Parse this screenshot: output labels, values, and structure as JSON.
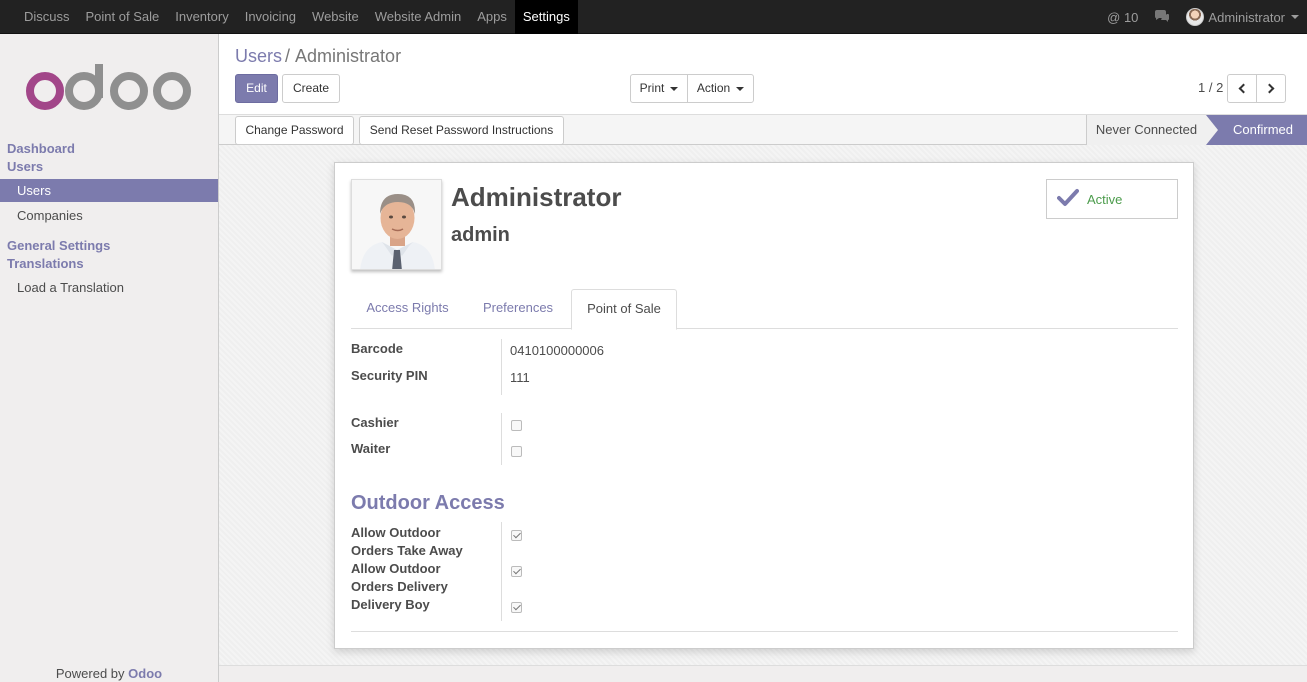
{
  "topbar": {
    "menu": [
      "Discuss",
      "Point of Sale",
      "Inventory",
      "Invoicing",
      "Website",
      "Website Admin",
      "Apps",
      "Settings"
    ],
    "active_menu": "Settings",
    "notifications": "@ 10",
    "user": "Administrator"
  },
  "sidebar": {
    "logo_text": "odoo",
    "sections": [
      {
        "title": "Dashboard"
      },
      {
        "title": "Users",
        "items": [
          "Users",
          "Companies"
        ]
      },
      {
        "title": "General Settings"
      },
      {
        "title": "Translations",
        "items": [
          "Load a Translation"
        ]
      }
    ],
    "active_item": "Users",
    "powered_by": "Powered by",
    "powered_brand": "Odoo"
  },
  "control_panel": {
    "breadcrumb_parent": "Users",
    "breadcrumb_sep": "/",
    "breadcrumb_current": "Administrator",
    "edit_label": "Edit",
    "create_label": "Create",
    "print_label": "Print",
    "action_label": "Action",
    "pager": "1 / 2"
  },
  "statusbar": {
    "change_password": "Change Password",
    "send_reset": "Send Reset Password Instructions",
    "stages": [
      "Never Connected",
      "Confirmed"
    ],
    "current_stage": "Confirmed"
  },
  "form": {
    "name": "Administrator",
    "login": "admin",
    "active_label": "Active",
    "tabs": [
      "Access Rights",
      "Preferences",
      "Point of Sale"
    ],
    "active_tab": "Point of Sale",
    "fields": {
      "barcode_label": "Barcode",
      "barcode_value": "0410100000006",
      "pin_label": "Security PIN",
      "pin_value": "111",
      "cashier_label": "Cashier",
      "cashier_checked": false,
      "waiter_label": "Waiter",
      "waiter_checked": false
    },
    "outdoor": {
      "title": "Outdoor Access",
      "take_away_label_1": "Allow Outdoor",
      "take_away_label_2": "Orders Take Away",
      "take_away_checked": true,
      "delivery_label_1": "Allow Outdoor",
      "delivery_label_2": "Orders Delivery",
      "delivery_checked": true,
      "delivery_boy_label": "Delivery Boy",
      "delivery_boy_checked": true
    }
  },
  "colors": {
    "accent": "#7c7bad",
    "topbar": "#222222",
    "active_green": "#4c9c4c"
  }
}
